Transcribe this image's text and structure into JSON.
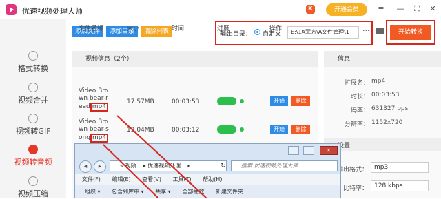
{
  "app": {
    "title": "优速视频处理大师",
    "vip_label": "开通会员",
    "k_badge": "K"
  },
  "window_controls": {
    "menu": "≡",
    "minimize": "—",
    "maximize": "⛶",
    "close": "✕"
  },
  "sidebar": {
    "items": [
      {
        "label": "格式转换",
        "icon": "format-convert-icon",
        "active": false
      },
      {
        "label": "视频合并",
        "icon": "merge-icon",
        "active": false
      },
      {
        "label": "视频转GIF",
        "icon": "gif-icon",
        "active": false
      },
      {
        "label": "视频转音频",
        "icon": "audio-icon",
        "active": true
      },
      {
        "label": "视频压缩",
        "icon": "compress-icon",
        "active": false
      }
    ]
  },
  "toolbar": {
    "add_file": "添加文件",
    "add_dir": "添加目录",
    "clear_list": "清除列表"
  },
  "output": {
    "label": "输出目录：",
    "option": "自定义",
    "path": "E:\\1A菲方\\A文件管理\\1",
    "browse": "···"
  },
  "start_button": "开始转换",
  "video_panel": {
    "title": "视频信息（2个）",
    "columns": [
      "文件名称",
      "大小",
      "时间",
      "进度",
      "操作"
    ],
    "rows": [
      {
        "name": "Video Brown bear-read",
        "ext": "mp4",
        "size": "17.57MB",
        "time": "00:03:53",
        "start": "开始",
        "delete": "删除"
      },
      {
        "name": "Video Brown bear-song",
        "ext": "mp4",
        "size": "13.04MB",
        "time": "00:03:12",
        "start": "开始",
        "delete": "删除"
      }
    ]
  },
  "info_panel": {
    "title": "信息",
    "rows": [
      {
        "label": "扩展名：",
        "value": "mp4"
      },
      {
        "label": "时长：",
        "value": "00:03:53"
      },
      {
        "label": "码率：",
        "value": "631327 bps"
      },
      {
        "label": "分辨率：",
        "value": "1152x720"
      }
    ],
    "settings_title": "设置",
    "format_label": "输出格式：",
    "format_value": "mp3",
    "bitrate_label": "比特率：",
    "bitrate_value": "128 kbps"
  },
  "explorer": {
    "address": "«  视频...  ▸  优速视频处理...  ▸",
    "search_placeholder": "搜索 优速视频处理大师",
    "menu": [
      "文件(F)",
      "编辑(E)",
      "查看(V)",
      "工具(T)",
      "帮助(H)"
    ],
    "toolbar": [
      "组织 ▾",
      "包含到库中 ▾",
      "共享 ▾",
      "全部播放",
      "新建文件夹"
    ],
    "refresh": "↻",
    "nav_back": "◂",
    "nav_fwd": "▸"
  },
  "colors": {
    "accent_blue": "#2e8ce6",
    "accent_orange": "#f15a24",
    "highlight_red": "#d9261c",
    "progress_green": "#2dbf4e"
  }
}
